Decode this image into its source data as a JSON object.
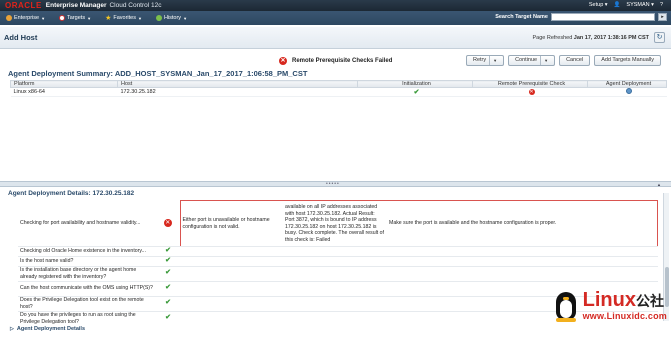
{
  "header": {
    "brand": "ORACLE",
    "product": "Enterprise Manager",
    "edition": "Cloud Control 12c",
    "setup": "Setup",
    "user": "SYSMAN",
    "menus": [
      {
        "label": "Enterprise",
        "icon": "enterprise-icon"
      },
      {
        "label": "Targets",
        "icon": "targets-icon"
      },
      {
        "label": "Favorites",
        "icon": "favorites-star-icon"
      },
      {
        "label": "History",
        "icon": "history-icon"
      }
    ],
    "search_label": "Search Target Name"
  },
  "page": {
    "title": "Add Host",
    "refreshed_label": "Page Refreshed",
    "refreshed_time": "Jan 17, 2017 1:38:16 PM CST"
  },
  "status": {
    "text": "Remote Prerequisite Checks Failed"
  },
  "buttons": {
    "retry": "Retry",
    "continue": "Continue",
    "cancel": "Cancel",
    "add_targets": "Add Targets Manually"
  },
  "summary": {
    "title": "Agent Deployment Summary: ADD_HOST_SYSMAN_Jan_17_2017_1:06:58_PM_CST",
    "columns": [
      "Platform",
      "Host",
      "Initialization",
      "Remote Prerequisite Check",
      "Agent Deployment"
    ],
    "row": {
      "platform": "Linux x86-64",
      "host": "172.30.25.182",
      "init": "success",
      "remote": "failed",
      "deploy": "pending"
    }
  },
  "details": {
    "title": "Agent Deployment Details: 172.30.25.182",
    "error_row": {
      "name": "Checking for port availability and hostname validity...",
      "message": "Either port is unavailable or hostname configuration is not valid.",
      "detail": "available on all IP addresses associated with host 172.30.25.182. Actual Result: Port 3872, which is bound to IP address 172.30.25.182 on host 172.30.25.182 is busy. Check complete. The overall result of this check is: Failed",
      "recommendation": "Make sure the port is available and the hostname configuration is proper."
    },
    "rows": [
      "Checking old Oracle Home existence in the inventory...",
      "Is the host name valid?",
      "Is the installation base directory or the agent home already registered with the inventory?",
      "Can the host communicate with the OMS using HTTP(S)?",
      "Does the Privilege Delegation tool exist on the remote host?",
      "Do you have the privileges to run as root using the Privilege Delegation tool?"
    ],
    "footer": "Agent Deployment Details"
  },
  "watermark": {
    "name": "Linux",
    "suffix": "公社",
    "url": "www.Linuxidc.com"
  },
  "colors": {
    "menubar": "#2d4760",
    "error": "#d7281e",
    "success": "#3a9a3a",
    "brand_red": "#e2231a"
  }
}
